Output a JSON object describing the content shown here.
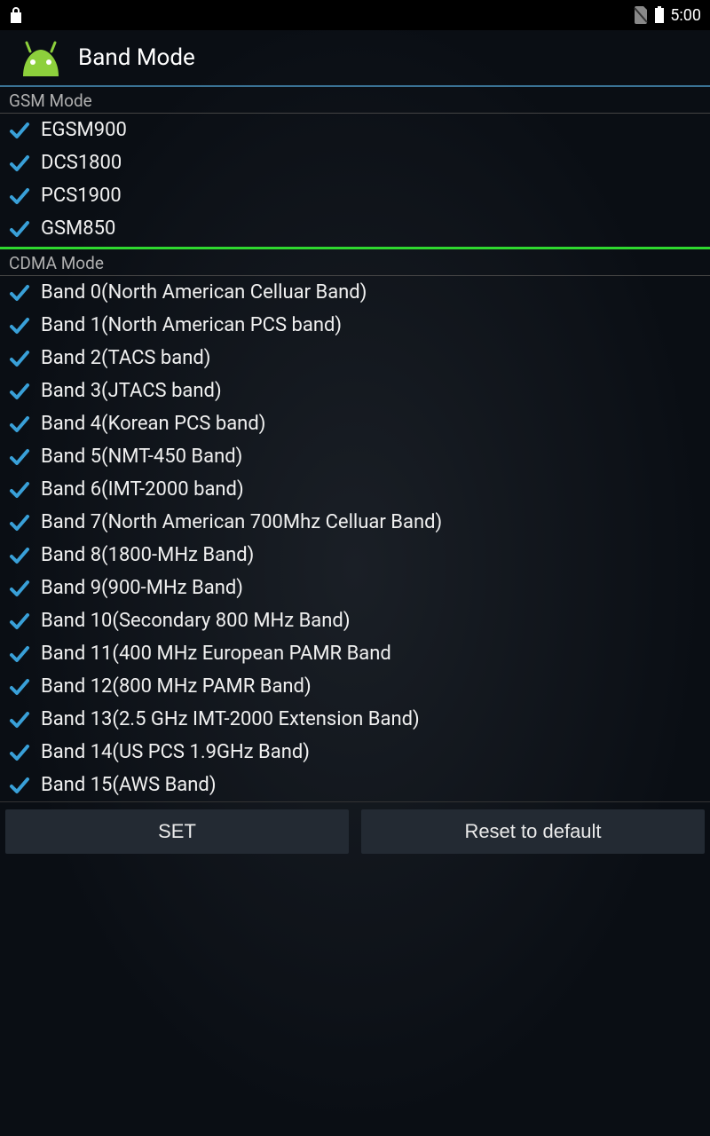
{
  "status": {
    "time": "5:00"
  },
  "header": {
    "title": "Band Mode"
  },
  "sections": {
    "gsm": {
      "title": "GSM Mode",
      "items": [
        {
          "label": "EGSM900"
        },
        {
          "label": "DCS1800"
        },
        {
          "label": "PCS1900"
        },
        {
          "label": "GSM850"
        }
      ]
    },
    "cdma": {
      "title": "CDMA Mode",
      "items": [
        {
          "label": "Band 0(North American Celluar Band)"
        },
        {
          "label": "Band 1(North American PCS band)"
        },
        {
          "label": "Band 2(TACS band)"
        },
        {
          "label": "Band 3(JTACS band)"
        },
        {
          "label": "Band 4(Korean PCS band)"
        },
        {
          "label": "Band 5(NMT-450 Band)"
        },
        {
          "label": "Band 6(IMT-2000 band)"
        },
        {
          "label": "Band 7(North American 700Mhz Celluar Band)"
        },
        {
          "label": "Band 8(1800-MHz Band)"
        },
        {
          "label": "Band 9(900-MHz Band)"
        },
        {
          "label": "Band 10(Secondary 800 MHz Band)"
        },
        {
          "label": "Band 11(400 MHz European PAMR Band"
        },
        {
          "label": "Band 12(800 MHz PAMR Band)"
        },
        {
          "label": "Band 13(2.5 GHz IMT-2000 Extension Band)"
        },
        {
          "label": "Band 14(US PCS 1.9GHz Band)"
        },
        {
          "label": "Band 15(AWS Band)"
        }
      ]
    }
  },
  "buttons": {
    "set": "SET",
    "reset": "Reset to default"
  }
}
